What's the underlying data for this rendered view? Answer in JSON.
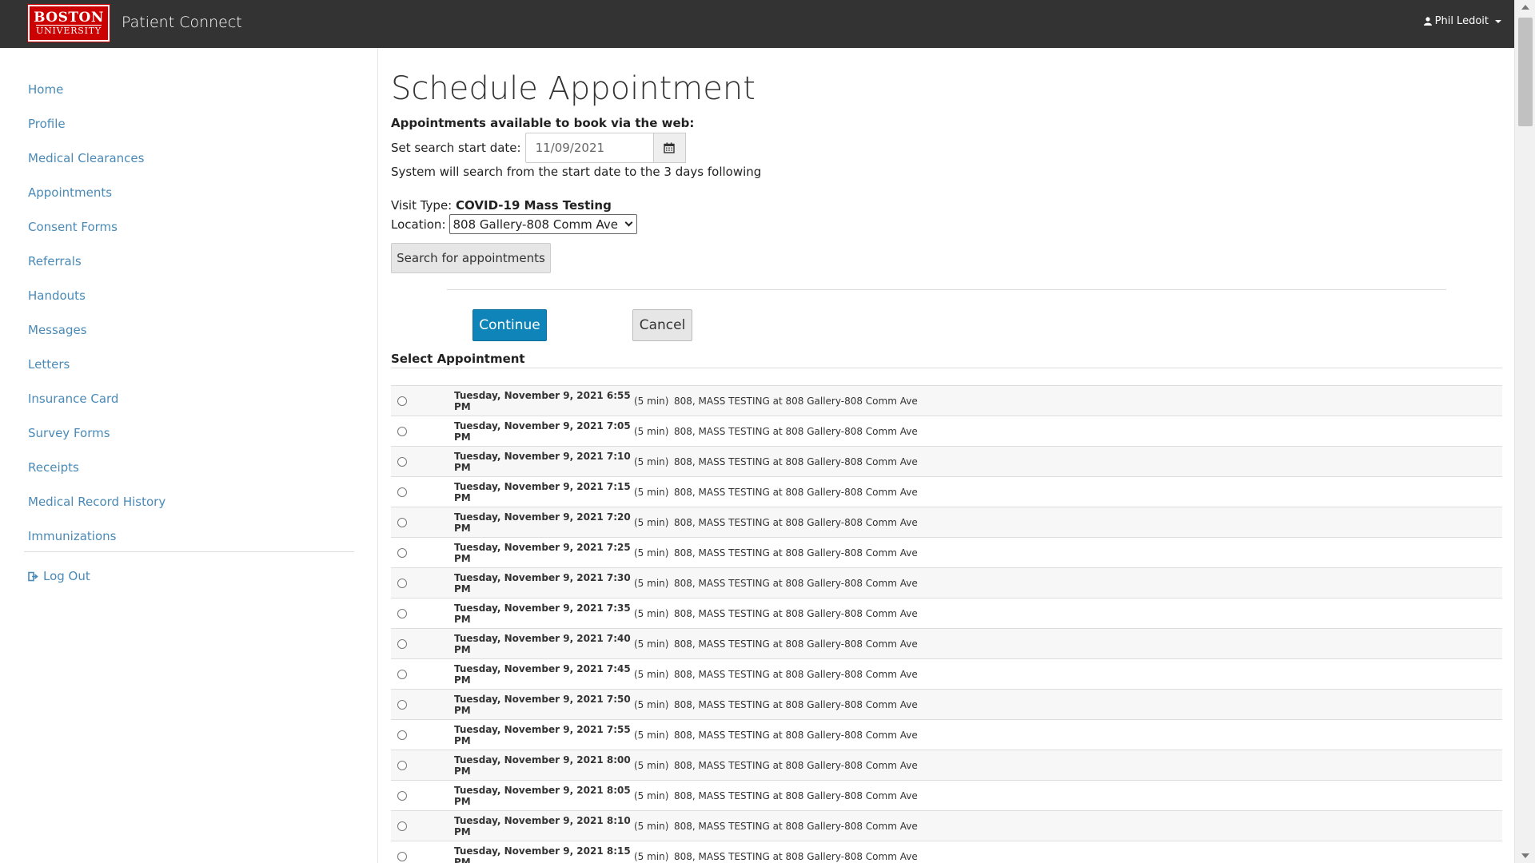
{
  "navbar": {
    "logo_line1": "BOSTON",
    "logo_line2": "UNIVERSITY",
    "app_title": "Patient Connect",
    "user_name": "Phil Ledoit"
  },
  "sidebar": {
    "items": [
      {
        "label": "Home"
      },
      {
        "label": "Profile"
      },
      {
        "label": "Medical Clearances"
      },
      {
        "label": "Appointments"
      },
      {
        "label": "Consent Forms"
      },
      {
        "label": "Referrals"
      },
      {
        "label": "Handouts"
      },
      {
        "label": "Messages"
      },
      {
        "label": "Letters"
      },
      {
        "label": "Insurance Card"
      },
      {
        "label": "Survey Forms"
      },
      {
        "label": "Receipts"
      },
      {
        "label": "Medical Record History"
      },
      {
        "label": "Immunizations"
      }
    ],
    "logout_label": "Log Out"
  },
  "main": {
    "title": "Schedule Appointment",
    "available_heading": "Appointments available to book via the web:",
    "start_date_label": "Set search start date:",
    "start_date_value": "11/09/2021",
    "search_note": "System will search from the start date to the 3 days following",
    "visit_type_label": "Visit Type:",
    "visit_type_value": "COVID-19 Mass Testing",
    "location_label": "Location:",
    "location_value": "808 Gallery-808 Comm Ave",
    "search_button": "Search for appointments",
    "continue_button": "Continue",
    "cancel_button": "Cancel",
    "select_heading": "Select Appointment"
  },
  "appointments": [
    {
      "datetime": "Tuesday, November 9, 2021 6:55 PM",
      "duration": "(5 min)",
      "description": "808, MASS TESTING at 808 Gallery-808 Comm Ave"
    },
    {
      "datetime": "Tuesday, November 9, 2021 7:05 PM",
      "duration": "(5 min)",
      "description": "808, MASS TESTING at 808 Gallery-808 Comm Ave"
    },
    {
      "datetime": "Tuesday, November 9, 2021 7:10 PM",
      "duration": "(5 min)",
      "description": "808, MASS TESTING at 808 Gallery-808 Comm Ave"
    },
    {
      "datetime": "Tuesday, November 9, 2021 7:15 PM",
      "duration": "(5 min)",
      "description": "808, MASS TESTING at 808 Gallery-808 Comm Ave"
    },
    {
      "datetime": "Tuesday, November 9, 2021 7:20 PM",
      "duration": "(5 min)",
      "description": "808, MASS TESTING at 808 Gallery-808 Comm Ave"
    },
    {
      "datetime": "Tuesday, November 9, 2021 7:25 PM",
      "duration": "(5 min)",
      "description": "808, MASS TESTING at 808 Gallery-808 Comm Ave"
    },
    {
      "datetime": "Tuesday, November 9, 2021 7:30 PM",
      "duration": "(5 min)",
      "description": "808, MASS TESTING at 808 Gallery-808 Comm Ave"
    },
    {
      "datetime": "Tuesday, November 9, 2021 7:35 PM",
      "duration": "(5 min)",
      "description": "808, MASS TESTING at 808 Gallery-808 Comm Ave"
    },
    {
      "datetime": "Tuesday, November 9, 2021 7:40 PM",
      "duration": "(5 min)",
      "description": "808, MASS TESTING at 808 Gallery-808 Comm Ave"
    },
    {
      "datetime": "Tuesday, November 9, 2021 7:45 PM",
      "duration": "(5 min)",
      "description": "808, MASS TESTING at 808 Gallery-808 Comm Ave"
    },
    {
      "datetime": "Tuesday, November 9, 2021 7:50 PM",
      "duration": "(5 min)",
      "description": "808, MASS TESTING at 808 Gallery-808 Comm Ave"
    },
    {
      "datetime": "Tuesday, November 9, 2021 7:55 PM",
      "duration": "(5 min)",
      "description": "808, MASS TESTING at 808 Gallery-808 Comm Ave"
    },
    {
      "datetime": "Tuesday, November 9, 2021 8:00 PM",
      "duration": "(5 min)",
      "description": "808, MASS TESTING at 808 Gallery-808 Comm Ave"
    },
    {
      "datetime": "Tuesday, November 9, 2021 8:05 PM",
      "duration": "(5 min)",
      "description": "808, MASS TESTING at 808 Gallery-808 Comm Ave"
    },
    {
      "datetime": "Tuesday, November 9, 2021 8:10 PM",
      "duration": "(5 min)",
      "description": "808, MASS TESTING at 808 Gallery-808 Comm Ave"
    },
    {
      "datetime": "Tuesday, November 9, 2021 8:15 PM",
      "duration": "(5 min)",
      "description": "808, MASS TESTING at 808 Gallery-808 Comm Ave"
    }
  ],
  "colors": {
    "navbar": "#333333",
    "brand_red": "#cc0000",
    "link": "#4a8ab7",
    "primary_button": "#0e84b8"
  }
}
